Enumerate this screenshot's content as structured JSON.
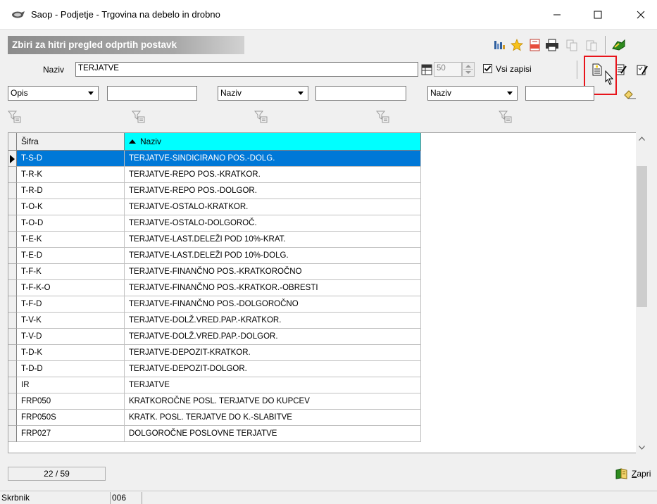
{
  "window": {
    "title": "Saop  - Podjetje - Trgovina na debelo in drobno",
    "minimize": "—",
    "maximize": "☐",
    "close": "✕"
  },
  "panel": {
    "banner": "Zbiri za hitri pregled odprtih postavk"
  },
  "search": {
    "label": "Naziv",
    "value": "TERJATVE",
    "limit": "50",
    "all_records_label": "Vsi zapisi",
    "all_records_checked": true
  },
  "filters": [
    {
      "field": "Opis",
      "value": ""
    },
    {
      "field": "Naziv",
      "value": ""
    },
    {
      "field": "Naziv",
      "value": ""
    }
  ],
  "table": {
    "columns": [
      "Šifra",
      "Naziv"
    ],
    "rows": [
      {
        "sifra": "T-S-D",
        "naziv": "TERJATVE-SINDICIRANO POS.-DOLG.",
        "selected": true
      },
      {
        "sifra": "T-R-K",
        "naziv": "TERJATVE-REPO POS.-KRATKOR."
      },
      {
        "sifra": "T-R-D",
        "naziv": "TERJATVE-REPO POS.-DOLGOR."
      },
      {
        "sifra": "T-O-K",
        "naziv": "TERJATVE-OSTALO-KRATKOR."
      },
      {
        "sifra": "T-O-D",
        "naziv": "TERJATVE-OSTALO-DOLGOROČ."
      },
      {
        "sifra": "T-E-K",
        "naziv": "TERJATVE-LAST.DELEŽI POD 10%-KRAT."
      },
      {
        "sifra": "T-E-D",
        "naziv": "TERJATVE-LAST.DELEŽI POD 10%-DOLG."
      },
      {
        "sifra": "T-F-K",
        "naziv": "TERJATVE-FINANČNO POS.-KRATKOROČNO"
      },
      {
        "sifra": "T-F-K-O",
        "naziv": "TERJATVE-FINANČNO POS.-KRATKOR.-OBRESTI"
      },
      {
        "sifra": "T-F-D",
        "naziv": "TERJATVE-FINANČNO POS.-DOLGOROČNO"
      },
      {
        "sifra": "T-V-K",
        "naziv": "TERJATVE-DOLŽ.VRED.PAP.-KRATKOR."
      },
      {
        "sifra": "T-V-D",
        "naziv": "TERJATVE-DOLŽ.VRED.PAP.-DOLGOR."
      },
      {
        "sifra": "T-D-K",
        "naziv": "TERJATVE-DEPOZIT-KRATKOR."
      },
      {
        "sifra": "T-D-D",
        "naziv": "TERJATVE-DEPOZIT-DOLGOR."
      },
      {
        "sifra": "IR",
        "naziv": "TERJATVE"
      },
      {
        "sifra": "FRP050",
        "naziv": "KRATKOROČNE POSL. TERJATVE DO KUPCEV"
      },
      {
        "sifra": "FRP050S",
        "naziv": "KRATK. POSL. TERJATVE DO K.-SLABITVE"
      },
      {
        "sifra": "FRP027",
        "naziv": "DOLGOROČNE POSLOVNE TERJATVE"
      }
    ]
  },
  "footer": {
    "record_count": "22 / 59",
    "close_hotkey": "Z",
    "close_rest": "apri"
  },
  "statusbar": {
    "user": "Skrbnik",
    "code": "006"
  },
  "colors": {
    "header_active": "#00ffff",
    "selection": "#0078d7",
    "highlight": "#e8141b"
  }
}
